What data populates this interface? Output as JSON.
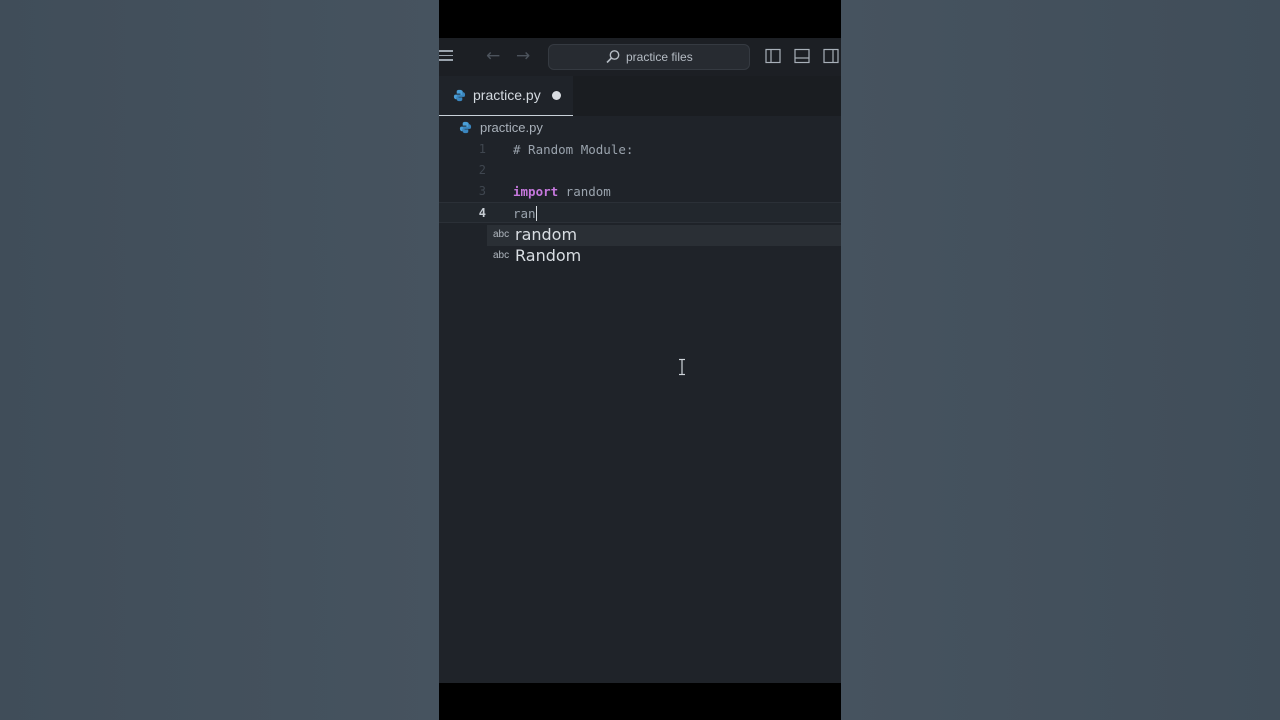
{
  "titlebar": {
    "search_placeholder": "practice files"
  },
  "tabs": [
    {
      "label": "practice.py",
      "modified": true
    }
  ],
  "breadcrumb": {
    "file": "practice.py"
  },
  "code_lines": [
    {
      "number": "1",
      "text": "# Random Module:"
    },
    {
      "number": "2",
      "text": ""
    },
    {
      "number": "3",
      "keyword": "import",
      "text": " random"
    },
    {
      "number": "4",
      "text": "ran",
      "current": true
    }
  ],
  "suggestions": [
    {
      "kind": "abc",
      "label": "random"
    },
    {
      "kind": "abc",
      "label": "Random"
    }
  ],
  "colors": {
    "keyword": "#c678dd",
    "python_icon": "#4a9fd8",
    "editor_bg": "#1f2329"
  }
}
